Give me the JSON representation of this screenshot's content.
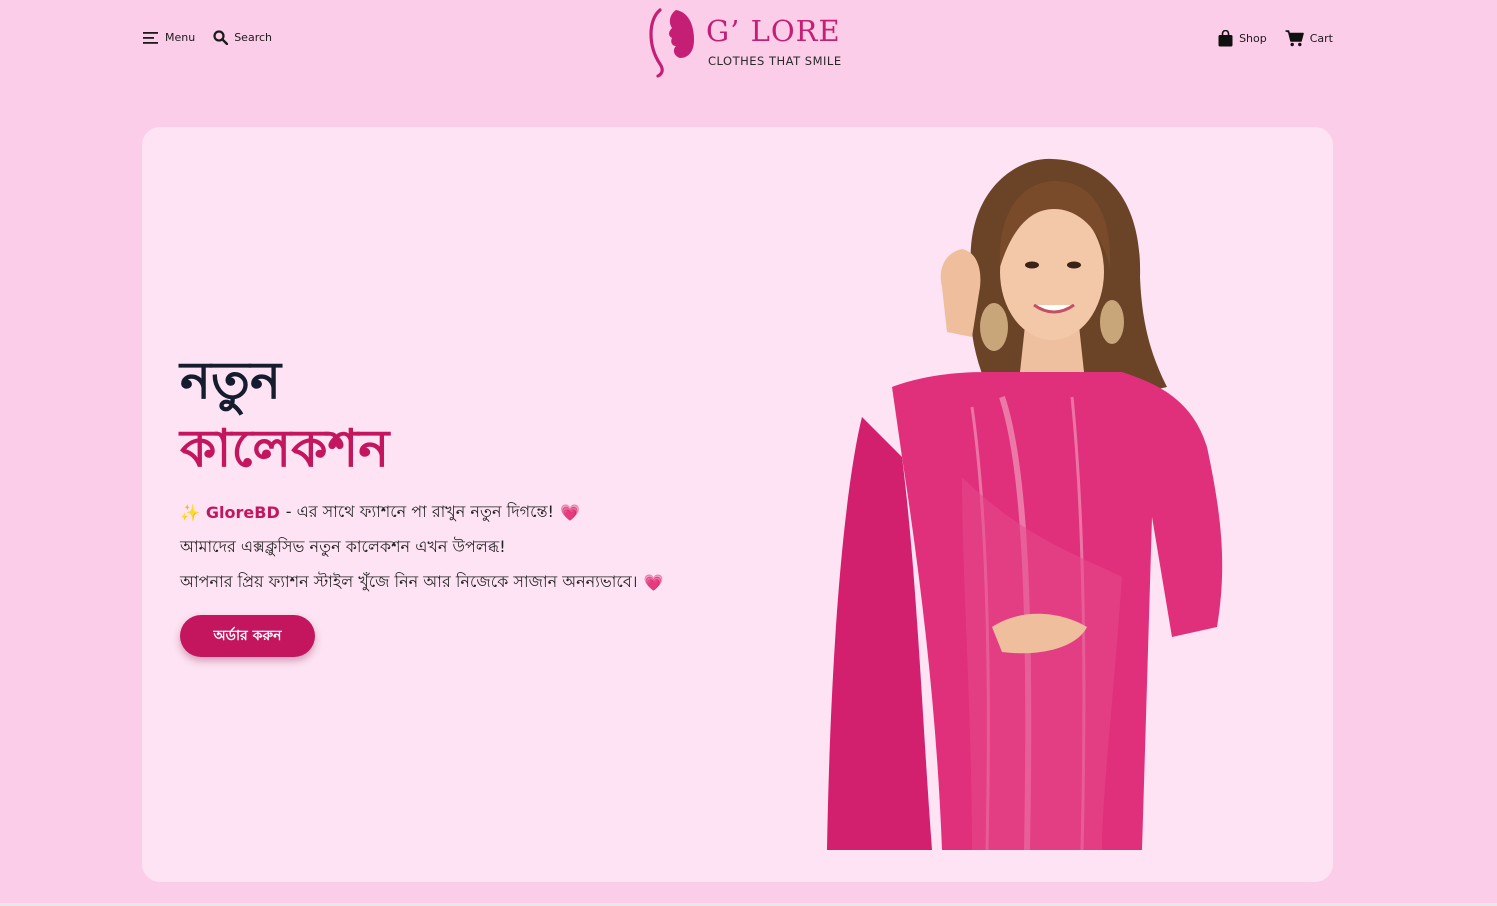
{
  "header": {
    "menu_label": "Menu",
    "search_label": "Search",
    "shop_label": "Shop",
    "cart_label": "Cart"
  },
  "logo": {
    "wordmark": "G’ LORE",
    "tagline": "CLOTHES THAT SMILE"
  },
  "hero": {
    "title_line1": "নতুন",
    "title_line2": "কালেকশন",
    "brand": "GloreBD",
    "line1_rest": "- এর সাথে ফ্যাশনে পা রাখুন নতুন দিগন্তে!",
    "line2": "আমাদের এক্সক্লুসিভ নতুন কালেকশন এখন উপলব্ধ!",
    "line3": "আপনার প্রিয় ফ্যাশন স্টাইল খুঁজে নিন আর নিজেকে সাজান অনন্যভাবে।",
    "order_button": "অর্ডার করুন",
    "sparkle_emoji": "✨",
    "heart_emoji": "💗"
  },
  "colors": {
    "page_bg": "#fbcde8",
    "card_bg": "#fde3f3",
    "accent": "#c3165e",
    "dark_text": "#141c2e"
  },
  "icons": [
    "menu-icon",
    "search-icon",
    "shopping-bag-icon",
    "cart-icon"
  ]
}
